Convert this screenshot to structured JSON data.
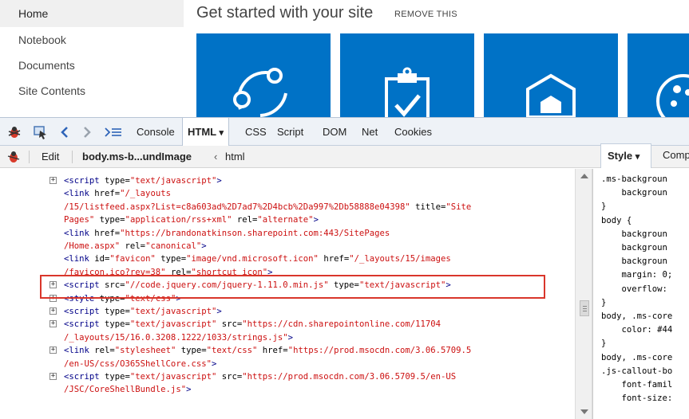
{
  "sharepoint": {
    "nav_items": [
      "Home",
      "Notebook",
      "Documents",
      "Site Contents"
    ],
    "get_started": {
      "title": "Get started with your site",
      "remove_label": "REMOVE THIS"
    },
    "tile_color": "#0072c6",
    "tiles": [
      {
        "icon": "share-icon"
      },
      {
        "icon": "clipboard-check-icon"
      },
      {
        "icon": "house-icon"
      },
      {
        "icon": "palette-icon"
      }
    ]
  },
  "firebug": {
    "toolbar_icons": [
      "firebug-icon",
      "inspect-icon",
      "back-icon",
      "forward-icon",
      "command-line-icon"
    ],
    "tabs": [
      "Console",
      "HTML",
      "CSS",
      "Script",
      "DOM",
      "Net",
      "Cookies"
    ],
    "active_tab": "HTML",
    "html_tab_arrow": "▾",
    "sub_toolbar": {
      "edit_label": "Edit",
      "breadcrumb_current": "body.ms-b...undImage",
      "breadcrumb_separator": "‹",
      "breadcrumb_parent": "html"
    },
    "side_tabs": {
      "style_label": "Style",
      "style_arrow": "▾",
      "computed_label": "Compu"
    }
  },
  "html_lines": [
    {
      "twisty": "+",
      "parts": [
        [
          "tag",
          "<script "
        ],
        [
          "attr",
          "type="
        ],
        [
          "val",
          "\"text/javascript\""
        ],
        [
          "tag",
          ">"
        ]
      ]
    },
    {
      "twisty": "",
      "parts": [
        [
          "tag",
          "<link "
        ],
        [
          "attr",
          "href="
        ],
        [
          "val",
          "\"/_layouts"
        ]
      ]
    },
    {
      "twisty": "",
      "parts": [
        [
          "val",
          "/15/listfeed.aspx?List=c8a603ad%2D7ad7%2D4bcb%2Da997%2Db58888e04398\""
        ],
        [
          "attr",
          " title="
        ],
        [
          "val",
          "\"Site"
        ]
      ]
    },
    {
      "twisty": "",
      "parts": [
        [
          "val",
          "Pages\""
        ],
        [
          "attr",
          " type="
        ],
        [
          "val",
          "\"application/rss+xml\""
        ],
        [
          "attr",
          " rel="
        ],
        [
          "val",
          "\"alternate\""
        ],
        [
          "tag",
          ">"
        ]
      ]
    },
    {
      "twisty": "",
      "parts": [
        [
          "tag",
          "<link "
        ],
        [
          "attr",
          "href="
        ],
        [
          "val",
          "\"https://brandonatkinson.sharepoint.com:443/SitePages"
        ]
      ]
    },
    {
      "twisty": "",
      "parts": [
        [
          "val",
          "/Home.aspx\""
        ],
        [
          "attr",
          " rel="
        ],
        [
          "val",
          "\"canonical\""
        ],
        [
          "tag",
          ">"
        ]
      ]
    },
    {
      "twisty": "",
      "parts": [
        [
          "tag",
          "<link "
        ],
        [
          "attr",
          "id="
        ],
        [
          "val",
          "\"favicon\""
        ],
        [
          "attr",
          " type="
        ],
        [
          "val",
          "\"image/vnd.microsoft.icon\""
        ],
        [
          "attr",
          " href="
        ],
        [
          "val",
          "\"/_layouts/15/images"
        ]
      ]
    },
    {
      "twisty": "",
      "parts": [
        [
          "val",
          "/favicon.ico?rev=38\""
        ],
        [
          "attr",
          " rel="
        ],
        [
          "val",
          "\"shortcut icon\""
        ],
        [
          "tag",
          ">"
        ]
      ]
    },
    {
      "twisty": "+",
      "parts": [
        [
          "tag",
          "<script "
        ],
        [
          "attr",
          "src="
        ],
        [
          "val",
          "\"//code.jquery.com/jquery-1.11.0.min.js\""
        ],
        [
          "attr",
          " type="
        ],
        [
          "val",
          "\"text/javascript\""
        ],
        [
          "tag",
          ">"
        ]
      ]
    },
    {
      "twisty": "+",
      "parts": [
        [
          "tag",
          "<style "
        ],
        [
          "attr",
          "type="
        ],
        [
          "val",
          "\"text/css\""
        ],
        [
          "tag",
          ">"
        ]
      ]
    },
    {
      "twisty": "+",
      "parts": [
        [
          "tag",
          "<script "
        ],
        [
          "attr",
          "type="
        ],
        [
          "val",
          "\"text/javascript\""
        ],
        [
          "tag",
          ">"
        ]
      ]
    },
    {
      "twisty": "+",
      "parts": [
        [
          "tag",
          "<script "
        ],
        [
          "attr",
          "type="
        ],
        [
          "val",
          "\"text/javascript\""
        ],
        [
          "attr",
          " src="
        ],
        [
          "val",
          "\"https://cdn.sharepointonline.com/11704"
        ]
      ]
    },
    {
      "twisty": "",
      "parts": [
        [
          "val",
          "/_layouts/15/16.0.3208.1222/1033/strings.js\""
        ],
        [
          "tag",
          ">"
        ]
      ]
    },
    {
      "twisty": "+",
      "parts": [
        [
          "tag",
          "<link "
        ],
        [
          "attr",
          "rel="
        ],
        [
          "val",
          "\"stylesheet\""
        ],
        [
          "attr",
          " type="
        ],
        [
          "val",
          "\"text/css\""
        ],
        [
          "attr",
          " href="
        ],
        [
          "val",
          "\"https://prod.msocdn.com/3.06.5709.5"
        ]
      ]
    },
    {
      "twisty": "",
      "parts": [
        [
          "val",
          "/en-US/css/O365ShellCore.css\""
        ],
        [
          "tag",
          ">"
        ]
      ]
    },
    {
      "twisty": "+",
      "parts": [
        [
          "tag",
          "<script "
        ],
        [
          "attr",
          "type="
        ],
        [
          "val",
          "\"text/javascript\""
        ],
        [
          "attr",
          " src="
        ],
        [
          "val",
          "\"https://prod.msocdn.com/3.06.5709.5/en-US"
        ]
      ]
    },
    {
      "twisty": "",
      "parts": [
        [
          "val",
          "/JSC/CoreShellBundle.js\""
        ],
        [
          "tag",
          ">"
        ]
      ]
    }
  ],
  "style_lines": [
    ".ms-backgroun",
    "    backgroun",
    "}",
    "body {",
    "    backgroun",
    "    backgroun",
    "    backgroun",
    "    margin: 0;",
    "    overflow: ",
    "}",
    "body, .ms-core",
    "    color: #44",
    "}",
    "body, .ms-core",
    ".js-callout-bo",
    "    font-famil",
    "    font-size:"
  ],
  "highlight_color": "#d9362b"
}
